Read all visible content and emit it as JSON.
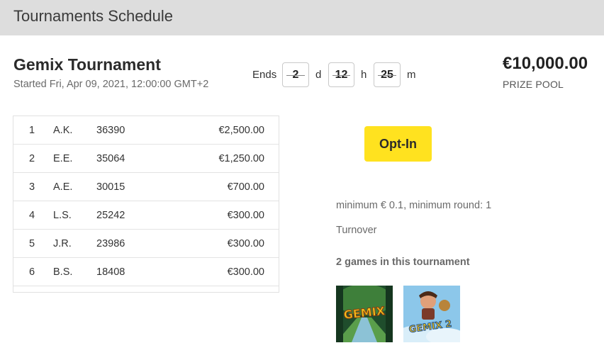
{
  "header": {
    "title": "Tournaments Schedule"
  },
  "tournament": {
    "name": "Gemix Tournament",
    "started": "Started Fri, Apr 09, 2021, 12:00:00 GMT+2"
  },
  "countdown": {
    "ends_label": "Ends",
    "days": "2",
    "days_unit": "d",
    "hours": "12",
    "hours_unit": "h",
    "minutes": "25",
    "minutes_unit": "m"
  },
  "prize": {
    "amount": "€10,000.00",
    "label": "PRIZE POOL"
  },
  "leaderboard": [
    {
      "rank": "1",
      "name": "A.K.",
      "score": "36390",
      "prize": "€2,500.00"
    },
    {
      "rank": "2",
      "name": "E.E.",
      "score": "35064",
      "prize": "€1,250.00"
    },
    {
      "rank": "3",
      "name": "A.E.",
      "score": "30015",
      "prize": "€700.00"
    },
    {
      "rank": "4",
      "name": "L.S.",
      "score": "25242",
      "prize": "€300.00"
    },
    {
      "rank": "5",
      "name": "J.R.",
      "score": "23986",
      "prize": "€300.00"
    },
    {
      "rank": "6",
      "name": "B.S.",
      "score": "18408",
      "prize": "€300.00"
    }
  ],
  "actions": {
    "optin_label": "Opt-In"
  },
  "rules": {
    "min_bet": "minimum € 0.1, minimum round: 1",
    "type": "Turnover",
    "games_count": "2 games in this tournament"
  },
  "games": [
    {
      "logo_text": "GEMIX",
      "icon": "gemix-game-icon"
    },
    {
      "logo_text": "GEMIX 2",
      "icon": "gemix-2-game-icon"
    }
  ],
  "colors": {
    "accent": "#ffe21f",
    "header_bg": "#dddddd"
  }
}
